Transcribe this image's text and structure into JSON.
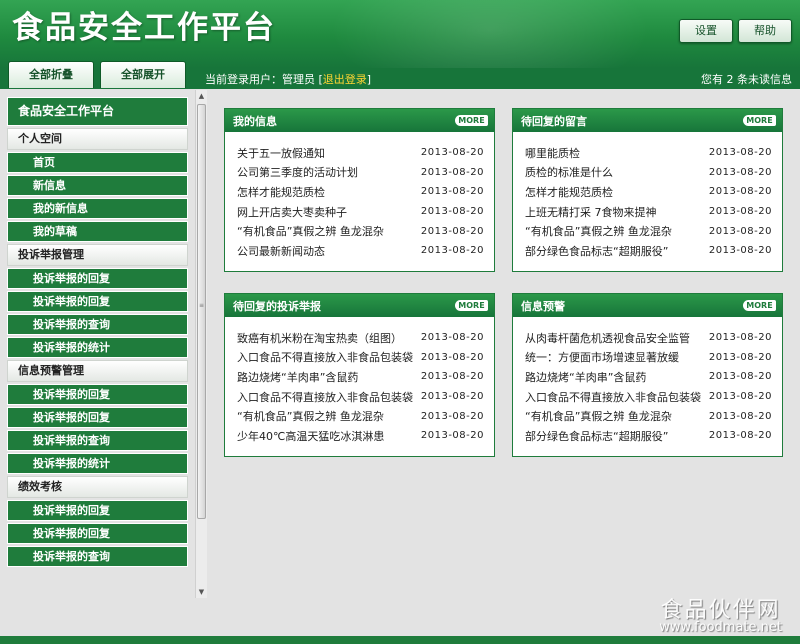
{
  "app": {
    "title": "食品安全工作平台"
  },
  "header": {
    "settings_label": "设置",
    "help_label": "帮助"
  },
  "toolbar": {
    "collapse_all_label": "全部折叠",
    "expand_all_label": "全部展开",
    "login_prefix": "当前登录用户：管理员 [",
    "logout_label": "退出登录",
    "login_suffix": "]",
    "unread_text": "您有 2 条未读信息"
  },
  "sidebar": {
    "title": "食品安全工作平台",
    "groups": [
      {
        "label": "个人空间",
        "items": [
          "首页",
          "新信息",
          "我的新信息",
          "我的草稿"
        ]
      },
      {
        "label": "投诉举报管理",
        "items": [
          "投诉举报的回复",
          "投诉举报的回复",
          "投诉举报的查询",
          "投诉举报的统计"
        ]
      },
      {
        "label": "信息预警管理",
        "items": [
          "投诉举报的回复",
          "投诉举报的回复",
          "投诉举报的查询",
          "投诉举报的统计"
        ]
      },
      {
        "label": "绩效考核",
        "items": [
          "投诉举报的回复",
          "投诉举报的回复",
          "投诉举报的查询"
        ]
      }
    ]
  },
  "panels": [
    {
      "title": "我的信息",
      "more_label": "MORE",
      "items": [
        {
          "title": "关于五一放假通知",
          "date": "2013-08-20"
        },
        {
          "title": "公司第三季度的活动计划",
          "date": "2013-08-20"
        },
        {
          "title": "怎样才能规范质检",
          "date": "2013-08-20"
        },
        {
          "title": "网上开店卖大枣卖种子",
          "date": "2013-08-20"
        },
        {
          "title": "“有机食品”真假之辨 鱼龙混杂",
          "date": "2013-08-20"
        },
        {
          "title": "公司最新新闻动态",
          "date": "2013-08-20"
        }
      ]
    },
    {
      "title": "待回复的留言",
      "more_label": "MORE",
      "items": [
        {
          "title": "哪里能质检",
          "date": "2013-08-20"
        },
        {
          "title": "质检的标准是什么",
          "date": "2013-08-20"
        },
        {
          "title": "怎样才能规范质检",
          "date": "2013-08-20"
        },
        {
          "title": "上班无精打采 7食物来提神",
          "date": "2013-08-20"
        },
        {
          "title": "“有机食品”真假之辨 鱼龙混杂",
          "date": "2013-08-20"
        },
        {
          "title": "部分绿色食品标志“超期服役”",
          "date": "2013-08-20"
        }
      ]
    },
    {
      "title": "待回复的投诉举报",
      "more_label": "MORE",
      "items": [
        {
          "title": "致癌有机米粉在淘宝热卖（组图）",
          "date": "2013-08-20"
        },
        {
          "title": "入口食品不得直接放入非食品包装袋",
          "date": "2013-08-20"
        },
        {
          "title": "路边烧烤“羊肉串”含鼠药",
          "date": "2013-08-20"
        },
        {
          "title": "入口食品不得直接放入非食品包装袋",
          "date": "2013-08-20"
        },
        {
          "title": "“有机食品”真假之辨 鱼龙混杂",
          "date": "2013-08-20"
        },
        {
          "title": "少年40℃高温天猛吃冰淇淋患",
          "date": "2013-08-20"
        }
      ]
    },
    {
      "title": "信息预警",
      "more_label": "MORE",
      "items": [
        {
          "title": "从肉毒杆菌危机透视食品安全监管",
          "date": "2013-08-20"
        },
        {
          "title": "统一：方便面市场增速显著放缓",
          "date": "2013-08-20"
        },
        {
          "title": "路边烧烤“羊肉串”含鼠药",
          "date": "2013-08-20"
        },
        {
          "title": "入口食品不得直接放入非食品包装袋",
          "date": "2013-08-20"
        },
        {
          "title": "“有机食品”真假之辨 鱼龙混杂",
          "date": "2013-08-20"
        },
        {
          "title": "部分绿色食品标志“超期服役”",
          "date": "2013-08-20"
        }
      ]
    }
  ],
  "watermark": {
    "name": "食品伙伴网",
    "url": "www.foodmate.net"
  },
  "colors": {
    "primary_green": "#1f7c3c",
    "header_green": "#2b9849",
    "logout_yellow": "#ffd633",
    "page_bg": "#e3e3e3"
  },
  "icons": {
    "more": "more-arrow-icon",
    "scroll_up": "scroll-up-arrow-icon",
    "scroll_down": "scroll-down-arrow-icon"
  }
}
